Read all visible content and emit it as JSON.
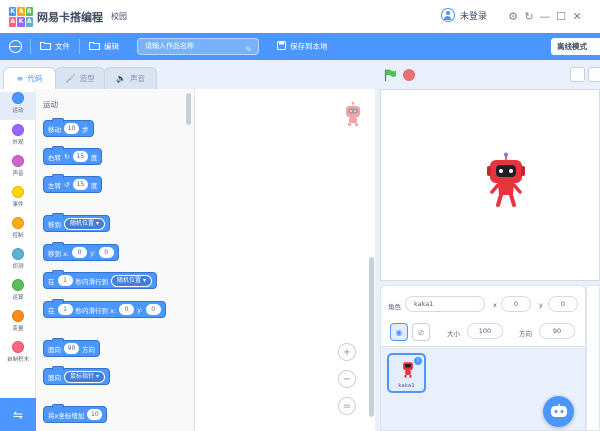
{
  "app": {
    "logo_letters": [
      "K",
      "A",
      "B",
      "A",
      "K",
      "A"
    ],
    "title": "网易卡搭编程",
    "school": "校园",
    "user_label": "未登录"
  },
  "menubar": {
    "file": "文件",
    "edit": "编辑",
    "project_placeholder": "请输入作品名称",
    "save_local": "保存到本地",
    "mode": "离线模式"
  },
  "tabs": [
    {
      "label": "代码",
      "icon": "code-icon"
    },
    {
      "label": "造型",
      "icon": "brush-icon"
    },
    {
      "label": "声音",
      "icon": "speaker-icon"
    }
  ],
  "categories": [
    {
      "label": "运动",
      "color": "#4c97ff"
    },
    {
      "label": "外观",
      "color": "#9966ff"
    },
    {
      "label": "声音",
      "color": "#cf63cf"
    },
    {
      "label": "事件",
      "color": "#ffd500"
    },
    {
      "label": "控制",
      "color": "#ffab19"
    },
    {
      "label": "侦测",
      "color": "#5cb1d6"
    },
    {
      "label": "运算",
      "color": "#59c059"
    },
    {
      "label": "变量",
      "color": "#ff8c1a"
    },
    {
      "label": "自制积木",
      "color": "#ff6680"
    }
  ],
  "palette": {
    "section_title": "运动",
    "blocks": {
      "move": {
        "a": "移动",
        "v": "10",
        "b": "步"
      },
      "turn_right": {
        "a": "右转",
        "v": "15",
        "b": "度"
      },
      "turn_left": {
        "a": "左转",
        "v": "15",
        "b": "度"
      },
      "goto": {
        "a": "移到",
        "d": "随机位置"
      },
      "goto_xy": {
        "a": "移到 x:",
        "x": "0",
        "b": "y:",
        "y": "0"
      },
      "glide": {
        "a": "在",
        "v": "1",
        "b": "秒内滑行到",
        "d": "随机位置"
      },
      "glide_xy": {
        "a": "在",
        "v": "1",
        "b": "秒内滑行到 x:",
        "x": "0",
        "c": "y:",
        "y": "0"
      },
      "point_dir": {
        "a": "面向",
        "v": "90",
        "b": "方向"
      },
      "point_towards": {
        "a": "面向",
        "d": "鼠标指针"
      },
      "change_x": {
        "a": "将x坐标增加",
        "v": "10"
      }
    }
  },
  "zoom": {
    "in": "+",
    "out": "−",
    "reset": "="
  },
  "sprite_info": {
    "sprite_label": "角色",
    "sprite_name": "kaka1",
    "x_label": "x",
    "x_value": "0",
    "y_label": "y",
    "y_value": "0",
    "size_label": "大小",
    "size_value": "100",
    "direction_label": "方向",
    "direction_value": "90"
  },
  "sprites": [
    {
      "name": "kaka1",
      "selected": true
    }
  ],
  "colors": {
    "accent": "#4c97ff",
    "motion": "#4c97ff",
    "robot": "#e8343f",
    "stop": "#ec6f6f",
    "flag": "#4cbf56"
  }
}
